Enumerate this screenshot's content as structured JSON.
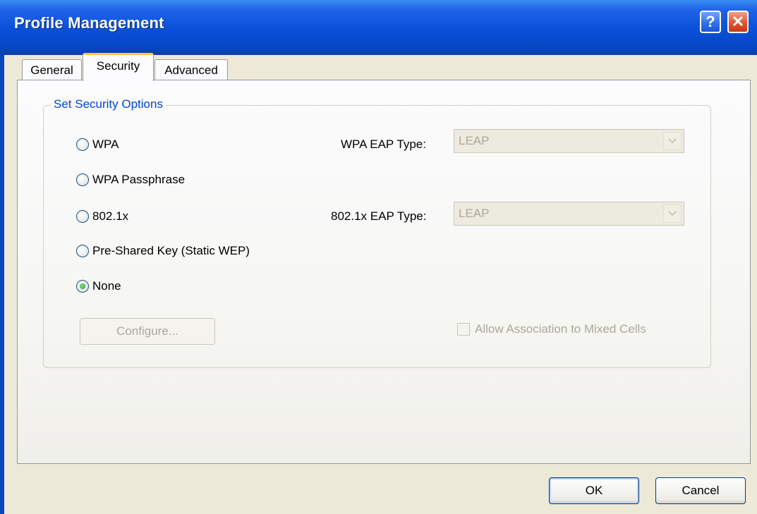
{
  "window": {
    "title": "Profile Management",
    "help_label": "?",
    "close_label": "✕"
  },
  "tabs": [
    {
      "label": "General",
      "selected": false
    },
    {
      "label": "Security",
      "selected": true
    },
    {
      "label": "Advanced",
      "selected": false
    }
  ],
  "security": {
    "group_title": "Set Security Options",
    "options": [
      {
        "label": "WPA",
        "checked": false
      },
      {
        "label": "WPA Passphrase",
        "checked": false
      },
      {
        "label": "802.1x",
        "checked": false
      },
      {
        "label": "Pre-Shared Key (Static WEP)",
        "checked": false
      },
      {
        "label": "None",
        "checked": true
      }
    ],
    "wpa_eap": {
      "label": "WPA EAP Type:",
      "value": "LEAP",
      "enabled": false
    },
    "dot1x_eap": {
      "label": "802.1x EAP Type:",
      "value": "LEAP",
      "enabled": false
    },
    "configure_label": "Configure...",
    "mixed_cells": {
      "label": "Allow Association to Mixed Cells",
      "checked": false,
      "enabled": false
    }
  },
  "footer": {
    "ok_label": "OK",
    "cancel_label": "Cancel"
  },
  "colors": {
    "title_bar": "#0747C4",
    "selected_tab_accent": "#FFC83C",
    "group_title": "#0046D5",
    "disabled_text": "#ACA899"
  }
}
